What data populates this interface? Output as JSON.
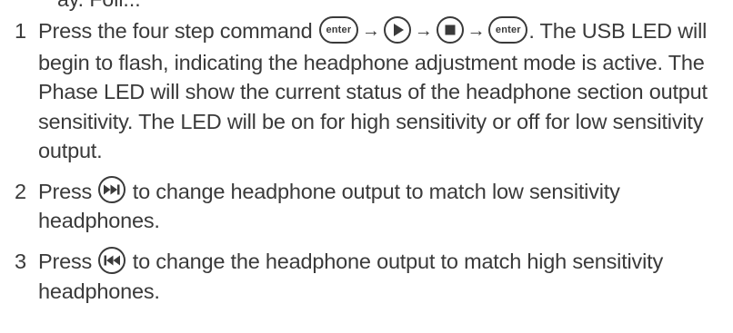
{
  "top_fragment": "ay. Foll...",
  "steps": [
    {
      "number": "1",
      "text_before": "Press the four step command",
      "buttons": [
        "enter",
        "play",
        "stop",
        "enter"
      ],
      "enter_label": "enter",
      "text_after": ". The USB LED will begin to flash, indicating the headphone adjustment mode is active. The Phase LED will show the current status of the headphone section output sensitivity. The LED will be on for high sensitivity or off for low sensitivity output."
    },
    {
      "number": "2",
      "text_before": "Press",
      "button": "next-track",
      "text_after": "to change headphone output to match low sensitivity headphones."
    },
    {
      "number": "3",
      "text_before": "Press",
      "button": "previous-track",
      "text_after": "to change the headphone output to match high sensitivity headphones."
    }
  ],
  "arrow_glyph": "→"
}
